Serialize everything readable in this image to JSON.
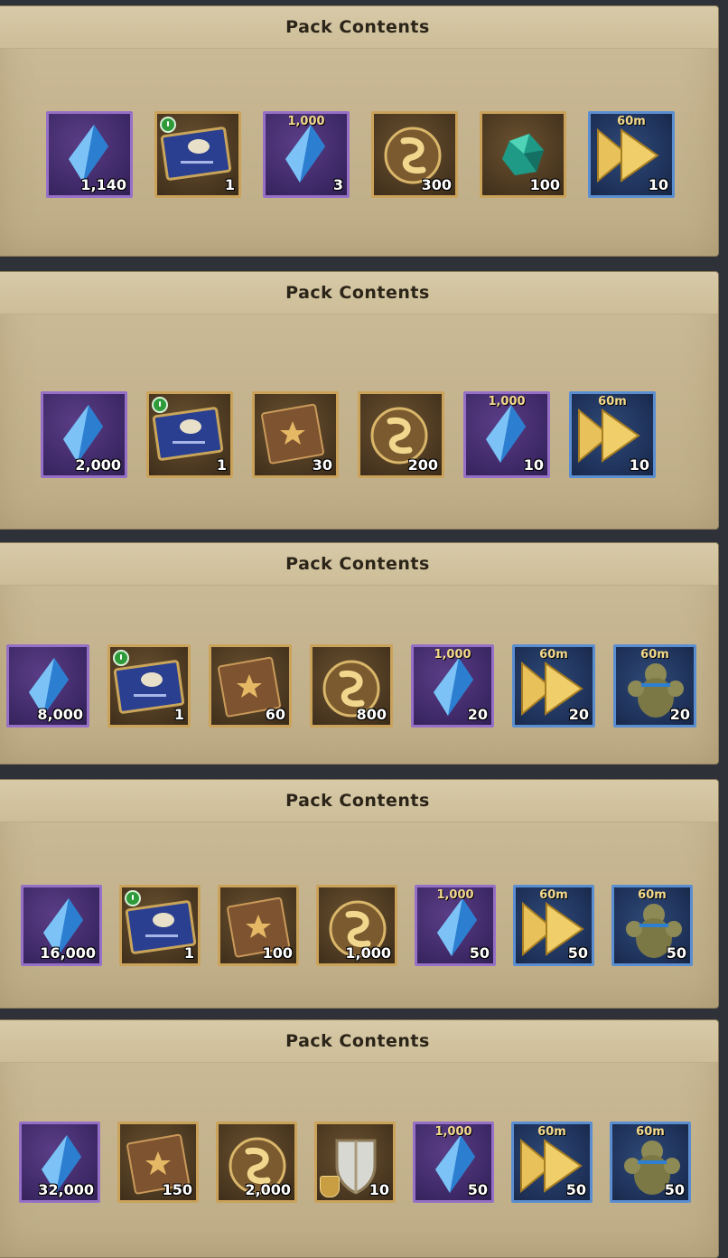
{
  "panels": [
    {
      "title": "Pack Contents",
      "items": [
        {
          "icon": "blue-crystal-icon",
          "qty": "1,140",
          "frame": "purple"
        },
        {
          "icon": "blue-card-icon",
          "qty": "1",
          "frame": "gold",
          "clock": true
        },
        {
          "icon": "blue-crystal-icon",
          "qty": "3",
          "frame": "purple",
          "label": "1,000"
        },
        {
          "icon": "gold-medallion-icon",
          "qty": "300",
          "frame": "gold"
        },
        {
          "icon": "green-gem-icon",
          "qty": "100",
          "frame": "gold"
        },
        {
          "icon": "speedup-arrows-icon",
          "qty": "10",
          "frame": "blue",
          "label": "60m"
        }
      ]
    },
    {
      "title": "Pack Contents",
      "items": [
        {
          "icon": "blue-crystal-icon",
          "qty": "2,000",
          "frame": "purple"
        },
        {
          "icon": "blue-card-icon",
          "qty": "1",
          "frame": "gold",
          "clock": true
        },
        {
          "icon": "tome-icon",
          "qty": "30",
          "frame": "gold"
        },
        {
          "icon": "gold-medallion-icon",
          "qty": "200",
          "frame": "gold"
        },
        {
          "icon": "blue-crystal-icon",
          "qty": "10",
          "frame": "purple",
          "label": "1,000"
        },
        {
          "icon": "speedup-arrows-icon",
          "qty": "10",
          "frame": "blue",
          "label": "60m"
        }
      ]
    },
    {
      "title": "Pack Contents",
      "items": [
        {
          "icon": "blue-crystal-icon",
          "qty": "8,000",
          "frame": "purple"
        },
        {
          "icon": "blue-card-icon",
          "qty": "1",
          "frame": "gold",
          "clock": true
        },
        {
          "icon": "tome-icon",
          "qty": "60",
          "frame": "gold"
        },
        {
          "icon": "gold-medallion-icon",
          "qty": "800",
          "frame": "gold"
        },
        {
          "icon": "blue-crystal-icon",
          "qty": "20",
          "frame": "purple",
          "label": "1,000"
        },
        {
          "icon": "speedup-arrows-icon",
          "qty": "20",
          "frame": "blue",
          "label": "60m"
        },
        {
          "icon": "training-dummy-icon",
          "qty": "20",
          "frame": "blue",
          "label": "60m"
        }
      ]
    },
    {
      "title": "Pack Contents",
      "items": [
        {
          "icon": "blue-crystal-icon",
          "qty": "16,000",
          "frame": "purple"
        },
        {
          "icon": "blue-card-icon",
          "qty": "1",
          "frame": "gold",
          "clock": true
        },
        {
          "icon": "tome-icon",
          "qty": "100",
          "frame": "gold"
        },
        {
          "icon": "gold-medallion-icon",
          "qty": "1,000",
          "frame": "gold"
        },
        {
          "icon": "blue-crystal-icon",
          "qty": "50",
          "frame": "purple",
          "label": "1,000"
        },
        {
          "icon": "speedup-arrows-icon",
          "qty": "50",
          "frame": "blue",
          "label": "60m"
        },
        {
          "icon": "training-dummy-icon",
          "qty": "50",
          "frame": "blue",
          "label": "60m"
        }
      ]
    },
    {
      "title": "Pack Contents",
      "items": [
        {
          "icon": "blue-crystal-icon",
          "qty": "32,000",
          "frame": "purple"
        },
        {
          "icon": "tome-icon",
          "qty": "150",
          "frame": "gold"
        },
        {
          "icon": "gold-medallion-icon",
          "qty": "2,000",
          "frame": "gold"
        },
        {
          "icon": "shield-icon",
          "qty": "10",
          "frame": "gold",
          "badge": true
        },
        {
          "icon": "blue-crystal-icon",
          "qty": "50",
          "frame": "purple",
          "label": "1,000"
        },
        {
          "icon": "speedup-arrows-icon",
          "qty": "50",
          "frame": "blue",
          "label": "60m"
        },
        {
          "icon": "training-dummy-icon",
          "qty": "50",
          "frame": "blue",
          "label": "60m"
        }
      ]
    }
  ]
}
